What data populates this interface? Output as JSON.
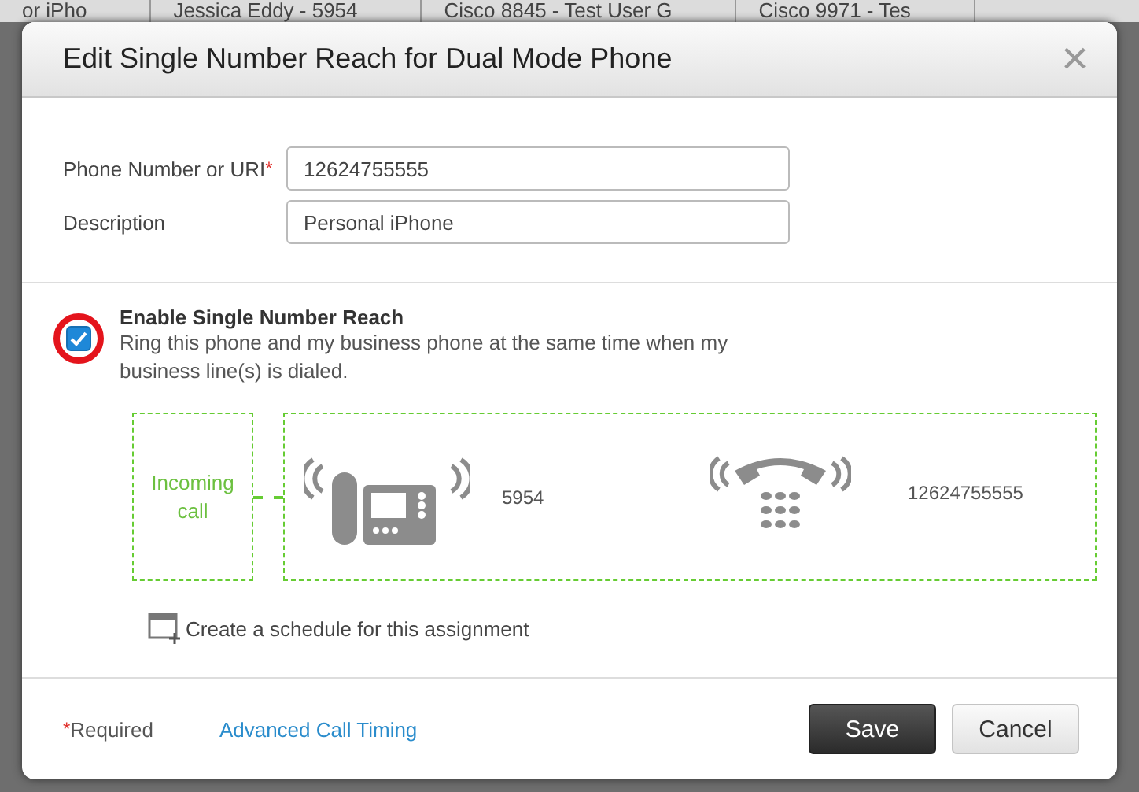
{
  "backdrop": {
    "cells": [
      "or iPho",
      "Jessica Eddy - 5954",
      "Cisco 8845 - Test User G",
      "Cisco 9971 - Tes"
    ]
  },
  "dialog": {
    "title": "Edit Single Number Reach for Dual Mode Phone",
    "close": "×"
  },
  "fields": [
    {
      "label": "Phone Number or URI",
      "required": true,
      "value": "12624755555"
    },
    {
      "label": "Description",
      "required": false,
      "value": "Personal iPhone"
    }
  ],
  "enable": {
    "checked": true,
    "highlighted": true,
    "title": "Enable Single Number Reach",
    "description": "Ring this phone and my business phone at the same time when my business line(s) is dialed."
  },
  "diagram": {
    "incoming": "Incoming call",
    "phones": [
      {
        "kind": "desk",
        "number": "5954"
      },
      {
        "kind": "mobile",
        "number": "12624755555"
      }
    ]
  },
  "schedule": {
    "label": "Create a schedule for this assignment"
  },
  "footer": {
    "required_mark": "*",
    "required": "Required",
    "link": "Advanced Call Timing"
  },
  "buttons": [
    {
      "label": "Save",
      "primary": true
    },
    {
      "label": "Cancel",
      "primary": false
    }
  ]
}
